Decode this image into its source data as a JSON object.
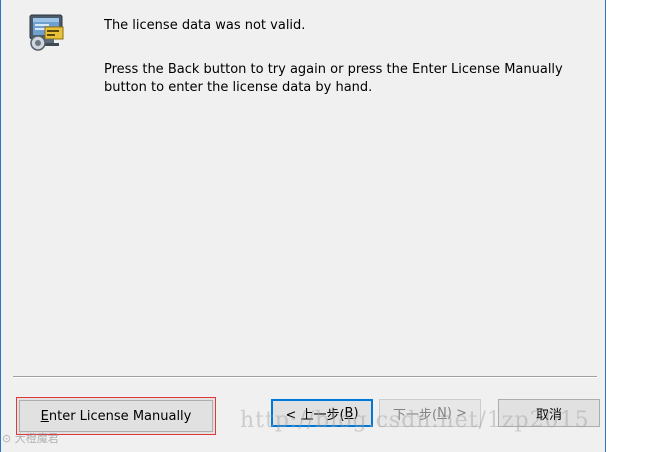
{
  "message": {
    "line1": "The license data was not valid.",
    "line2": "Press the Back button to try again or press the Enter License Manually button to enter the license data by hand."
  },
  "buttons": {
    "enter_manually_mnemonic": "E",
    "enter_manually_rest": "nter License Manually",
    "back_prefix": "< 上一步(",
    "back_mnemonic": "B",
    "back_suffix": ")",
    "next_prefix": "下一步(",
    "next_mnemonic": "N",
    "next_suffix": ") >",
    "cancel": "取消"
  },
  "watermark": {
    "url_text": "http://blog.csdn.net/1zp2015",
    "logo_text": "⊙ 大橙魔君"
  },
  "icons": {
    "app": "license-key-computer-icon"
  },
  "colors": {
    "accent": "#0078d7",
    "highlight": "#e0383b",
    "dialog_bg": "#f0f0f0",
    "window_border": "#2b75c9"
  }
}
